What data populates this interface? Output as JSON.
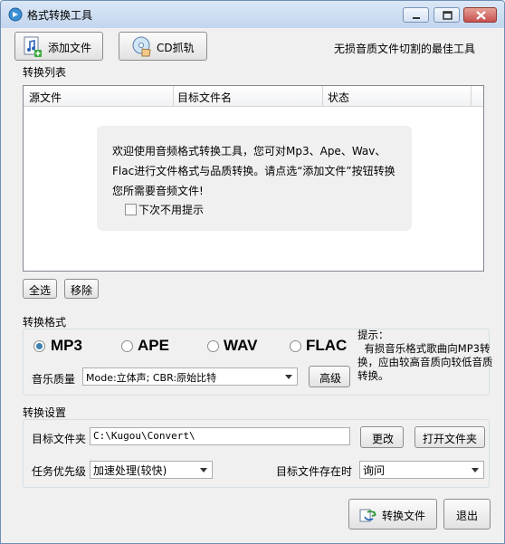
{
  "window": {
    "title": "格式转换工具"
  },
  "toolbar": {
    "add_file_label": "添加文件",
    "cd_rip_label": "CD抓轨",
    "slogan": "无损音质文件切割的最佳工具"
  },
  "convert_list": {
    "section_label": "转换列表",
    "columns": [
      "源文件",
      "目标文件名",
      "状态"
    ],
    "welcome_text": "欢迎使用音频格式转换工具，您可对Mp3、Ape、Wav、Flac进行文件格式与品质转换。请点选“添加文件”按钮转换您所需要音频文件!",
    "dont_show_label": "下次不用提示",
    "select_all_label": "全选",
    "remove_label": "移除"
  },
  "format": {
    "section_label": "转换格式",
    "options": [
      "MP3",
      "APE",
      "WAV",
      "FLAC"
    ],
    "selected": "MP3",
    "hint": "提示：\n  有损音乐格式歌曲向MP3转换，应由较高音质向较低音质转换。",
    "quality_label": "音乐质量",
    "quality_value": "Mode:立体声; CBR:原始比特",
    "advanced_label": "高级"
  },
  "settings": {
    "section_label": "转换设置",
    "target_folder_label": "目标文件夹",
    "target_folder_value": "C:\\Kugou\\Convert\\",
    "change_label": "更改",
    "open_folder_label": "打开文件夹",
    "priority_label": "任务优先级",
    "priority_value": "加速处理(较快)",
    "exists_label": "目标文件存在时",
    "exists_value": "询问"
  },
  "footer": {
    "convert_label": "转换文件",
    "exit_label": "退出"
  },
  "colors": {
    "titlebar": "#c3d6ee",
    "close_button": "#c75050",
    "radio_selected": "#3c7fb1"
  }
}
